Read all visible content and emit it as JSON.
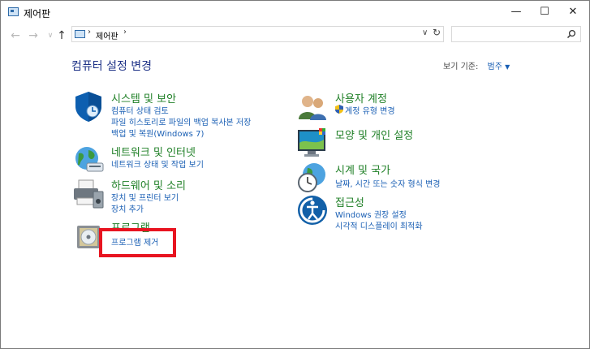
{
  "window": {
    "title": "제어판"
  },
  "address": {
    "crumb": "제어판"
  },
  "header": {
    "title": "컴퓨터 설정 변경",
    "viewby_label": "보기 기준:",
    "viewby_value": "범주"
  },
  "left": [
    {
      "title": "시스템 및 보안",
      "links": [
        "컴퓨터 상태 검토",
        "파일 히스토리로 파일의 백업 복사본 저장",
        "백업 및 복원(Windows 7)"
      ]
    },
    {
      "title": "네트워크 및 인터넷",
      "links": [
        "네트워크 상태 및 작업 보기"
      ]
    },
    {
      "title": "하드웨어 및 소리",
      "links": [
        "장치 및 프린터 보기",
        "장치 추가"
      ]
    },
    {
      "title": "프로그램",
      "links": [
        "프로그램 제거"
      ]
    }
  ],
  "right": [
    {
      "title": "사용자 계정",
      "links": [
        "계정 유형 변경"
      ]
    },
    {
      "title": "모양 및 개인 설정",
      "links": []
    },
    {
      "title": "시계 및 국가",
      "links": [
        "날짜, 시간 또는 숫자 형식 변경"
      ]
    },
    {
      "title": "접근성",
      "links": [
        "Windows 권장 설정",
        "시각적 디스플레이 최적화"
      ]
    }
  ],
  "colors": {
    "title_green": "#1e7f25",
    "link_blue": "#1a5fb4",
    "heading_blue": "#1e3287",
    "highlight_red": "#e81420"
  }
}
